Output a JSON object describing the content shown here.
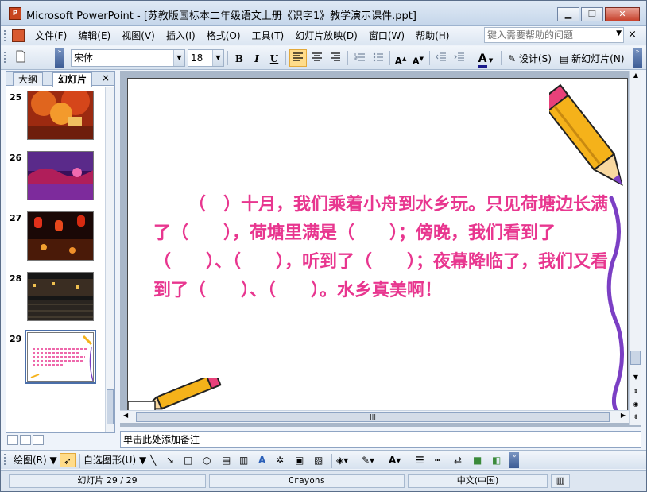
{
  "window": {
    "title": "Microsoft PowerPoint - [苏教版国标本二年级语文上册《识字1》教学演示课件.ppt]",
    "app_icon": "P",
    "minimize": "▁",
    "restore": "❐",
    "close": "✕"
  },
  "menu": {
    "items": [
      "文件(F)",
      "编辑(E)",
      "视图(V)",
      "插入(I)",
      "格式(O)",
      "工具(T)",
      "幻灯片放映(D)",
      "窗口(W)",
      "帮助(H)"
    ],
    "help_placeholder": "键入需要帮助的问题",
    "help_close": "×"
  },
  "formatting": {
    "font_name": "宋体",
    "font_size": "18",
    "bold": "B",
    "italic": "I",
    "underline": "U",
    "design_label": "设计(S)",
    "new_slide_label": "新幻灯片(N)"
  },
  "panel": {
    "tabs": [
      "大纲",
      "幻灯片"
    ],
    "close": "×",
    "slides": [
      {
        "number": "25"
      },
      {
        "number": "26"
      },
      {
        "number": "27"
      },
      {
        "number": "28"
      },
      {
        "number": "29"
      }
    ]
  },
  "slide": {
    "body_text": "（　）十月，我们乘着小舟到水乡玩。只见荷塘边长满了（　　），荷塘里满是（　　）；傍晚，我们看到了（　　）、（　　），听到了（　　）；夜幕降临了，我们又看到了（　　）、（　　）。水乡真美啊！",
    "text_color": "#e8368f",
    "pencil_colors": [
      "#f5b21a",
      "#7b3fc4"
    ]
  },
  "notes": {
    "placeholder": "单击此处添加备注"
  },
  "drawing": {
    "draw_label": "绘图(R)",
    "autoshape_label": "自选图形(U)"
  },
  "status": {
    "slide_position": "幻灯片 29 / 29",
    "design_template": "Crayons",
    "language": "中文(中国)"
  }
}
